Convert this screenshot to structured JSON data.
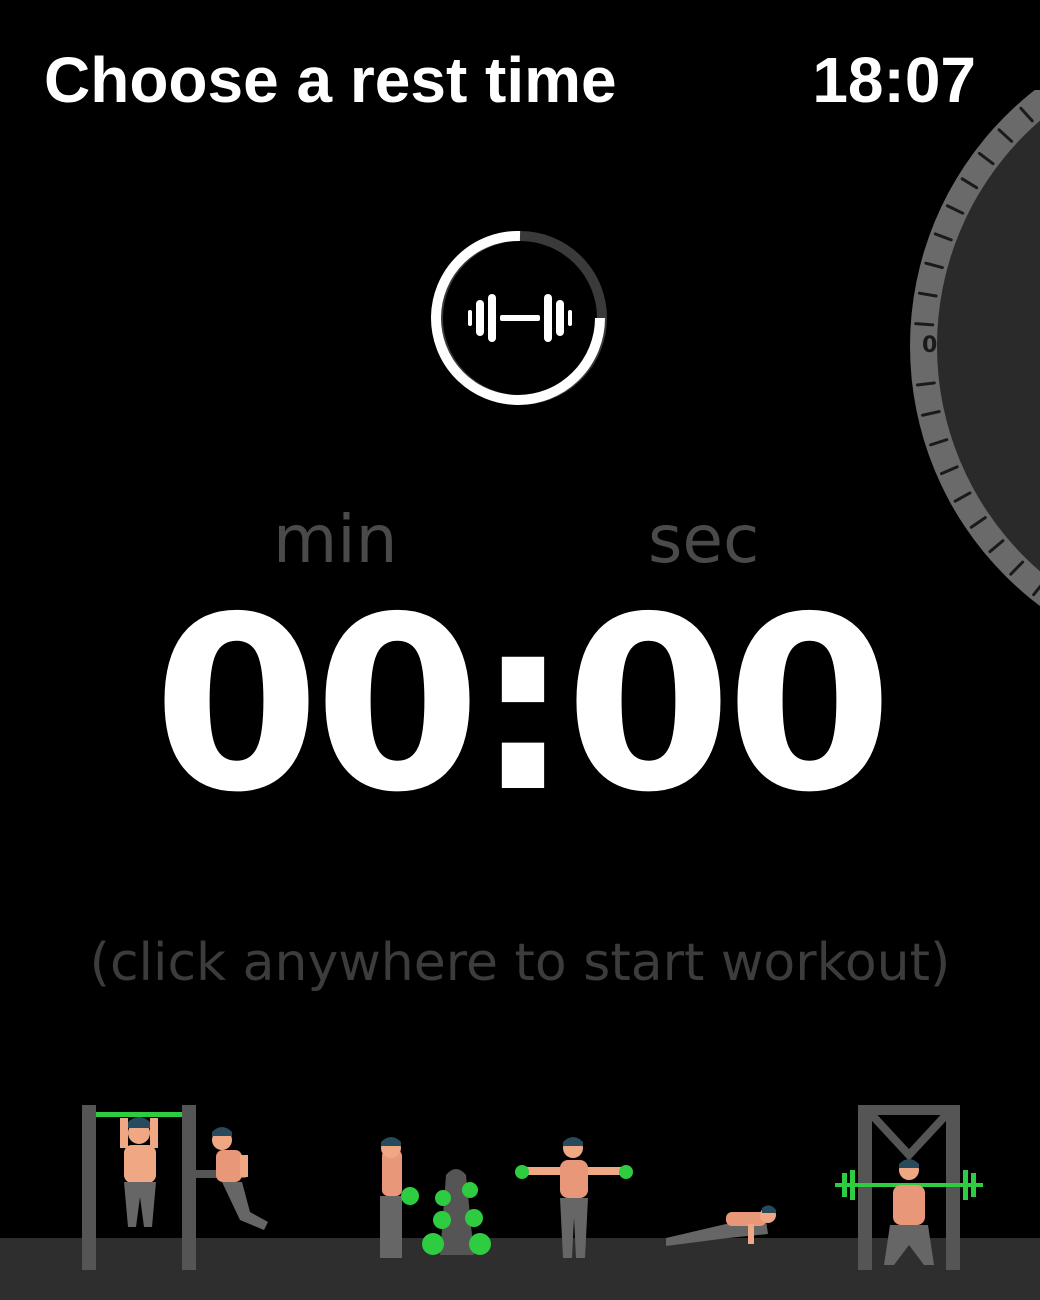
{
  "header": {
    "title": "Choose a rest time",
    "clock": "18:07"
  },
  "crown": {
    "label": "0"
  },
  "timer": {
    "min_label": "min",
    "sec_label": "sec",
    "value": "00:00"
  },
  "hint": "(click anywhere to start workout)",
  "icons": {
    "workout": "dumbbell-icon",
    "progress_ring": "activity-ring"
  },
  "colors": {
    "background": "#000000",
    "text": "#ffffff",
    "muted": "#4a4a4a",
    "equipment": "#2ecc40",
    "floor": "#2e2e2e"
  }
}
